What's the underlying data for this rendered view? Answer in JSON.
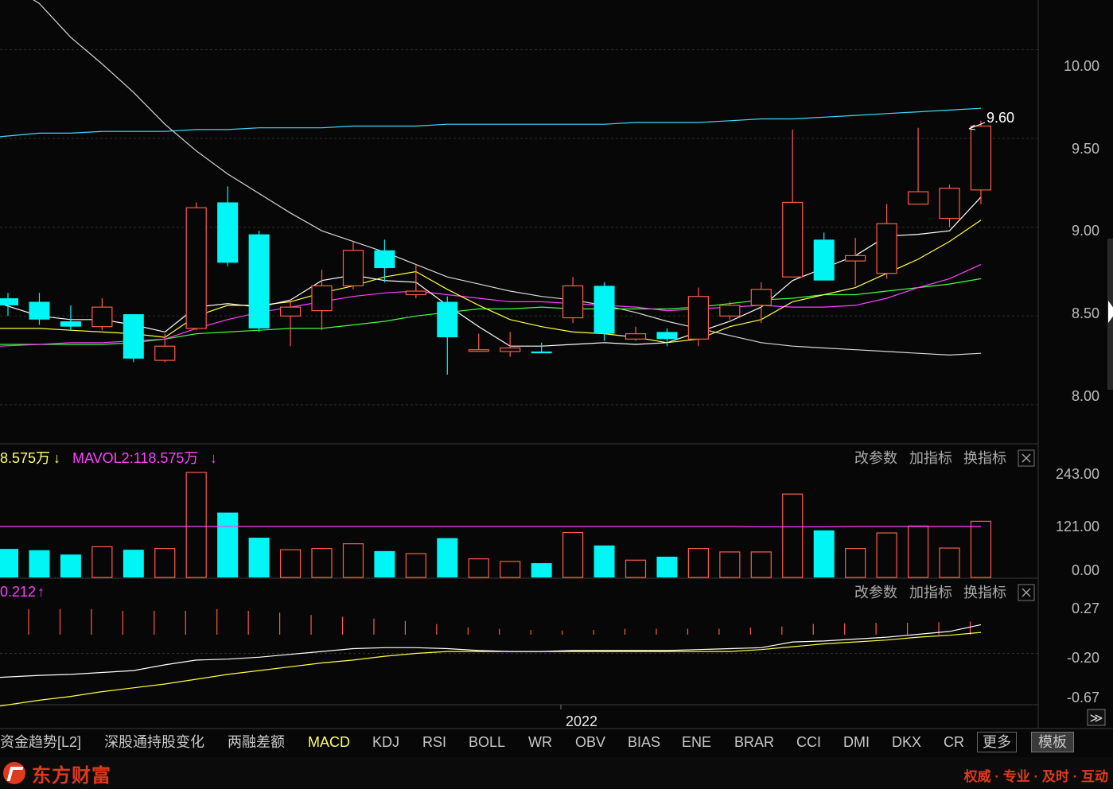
{
  "colors": {
    "up": "#ff5a4a",
    "down": "#00f5f5",
    "ma5": "#ffffff",
    "ma10": "#ffff40",
    "ma20": "#ff40ff",
    "ma30": "#40ff40",
    "ma60": "#e8e8e8",
    "ma250": "#40d8ff",
    "accent_text": "#ffff66",
    "brand": "#e03a1e"
  },
  "main_panel": {
    "y_ticks": [
      "10.00",
      "9.50",
      "9.00",
      "8.50",
      "8.00"
    ],
    "max_label": "9.60"
  },
  "volume_panel": {
    "legend_yellow": "8.575万",
    "legend_yellow_arrow": "↓",
    "legend_magenta": "MAVOL2:118.575万",
    "legend_magenta_arrow": "↓",
    "y_ticks": [
      "243.00",
      "121.00",
      "0.00"
    ],
    "buttons": {
      "params": "改参数",
      "add": "加指标",
      "swap": "换指标"
    }
  },
  "macd_panel": {
    "legend": "0.212",
    "legend_arrow": "↑",
    "y_ticks": [
      "0.27",
      "-0.20",
      "-0.67"
    ],
    "buttons": {
      "params": "改参数",
      "add": "加指标",
      "swap": "换指标"
    }
  },
  "x_axis": {
    "year_label": "2022",
    "expand_symbol": "≫"
  },
  "tabs": [
    "资金趋势[L2]",
    "深股通持股变化",
    "两融差额",
    "MACD",
    "KDJ",
    "RSI",
    "BOLL",
    "WR",
    "OBV",
    "BIAS",
    "ENE",
    "BRAR",
    "CCI",
    "DMI",
    "DKX",
    "CR"
  ],
  "active_tab": "MACD",
  "more_button": "更多",
  "template_button": "模板",
  "footer": {
    "logo_text": "东方财富",
    "slogan": "权威 · 专业 · 及时 · 互动"
  },
  "chart_data": {
    "type": "candlestick",
    "candles": [
      {
        "o": 8.6,
        "c": 8.56,
        "h": 8.63,
        "l": 8.5
      },
      {
        "o": 8.58,
        "c": 8.48,
        "h": 8.63,
        "l": 8.45
      },
      {
        "o": 8.47,
        "c": 8.44,
        "h": 8.56,
        "l": 8.42
      },
      {
        "o": 8.44,
        "c": 8.55,
        "h": 8.6,
        "l": 8.42
      },
      {
        "o": 8.51,
        "c": 8.26,
        "h": 8.51,
        "l": 8.24
      },
      {
        "o": 8.25,
        "c": 8.33,
        "h": 8.4,
        "l": 8.24
      },
      {
        "o": 8.43,
        "c": 9.11,
        "h": 9.14,
        "l": 8.42
      },
      {
        "o": 9.14,
        "c": 8.8,
        "h": 9.23,
        "l": 8.78
      },
      {
        "o": 8.96,
        "c": 8.43,
        "h": 8.98,
        "l": 8.41
      },
      {
        "o": 8.5,
        "c": 8.55,
        "h": 8.59,
        "l": 8.33
      },
      {
        "o": 8.53,
        "c": 8.67,
        "h": 8.76,
        "l": 8.42
      },
      {
        "o": 8.67,
        "c": 8.87,
        "h": 8.92,
        "l": 8.65
      },
      {
        "o": 8.87,
        "c": 8.77,
        "h": 8.93,
        "l": 8.69
      },
      {
        "o": 8.62,
        "c": 8.64,
        "h": 8.79,
        "l": 8.6
      },
      {
        "o": 8.58,
        "c": 8.38,
        "h": 8.61,
        "l": 8.17
      },
      {
        "o": 8.31,
        "c": 8.31,
        "h": 8.4,
        "l": 8.31
      },
      {
        "o": 8.3,
        "c": 8.32,
        "h": 8.41,
        "l": 8.27
      },
      {
        "o": 8.3,
        "c": 8.29,
        "h": 8.35,
        "l": 8.29
      },
      {
        "o": 8.49,
        "c": 8.67,
        "h": 8.72,
        "l": 8.46
      },
      {
        "o": 8.67,
        "c": 8.4,
        "h": 8.69,
        "l": 8.36
      },
      {
        "o": 8.37,
        "c": 8.4,
        "h": 8.44,
        "l": 8.36
      },
      {
        "o": 8.41,
        "c": 8.37,
        "h": 8.43,
        "l": 8.33
      },
      {
        "o": 8.37,
        "c": 8.61,
        "h": 8.66,
        "l": 8.33
      },
      {
        "o": 8.5,
        "c": 8.56,
        "h": 8.58,
        "l": 8.48
      },
      {
        "o": 8.56,
        "c": 8.65,
        "h": 8.69,
        "l": 8.46
      },
      {
        "o": 8.72,
        "c": 9.14,
        "h": 9.55,
        "l": 8.72
      },
      {
        "o": 8.93,
        "c": 8.7,
        "h": 8.97,
        "l": 8.7
      },
      {
        "o": 8.81,
        "c": 8.84,
        "h": 8.94,
        "l": 8.67
      },
      {
        "o": 8.74,
        "c": 9.02,
        "h": 9.13,
        "l": 8.71
      },
      {
        "o": 9.13,
        "c": 9.2,
        "h": 9.56,
        "l": 9.13
      },
      {
        "o": 9.05,
        "c": 9.22,
        "h": 9.24,
        "l": 9.0
      },
      {
        "o": 9.21,
        "c": 9.57,
        "h": 9.6,
        "l": 9.13
      }
    ],
    "volume": [
      66,
      63,
      53,
      71,
      64,
      67,
      243,
      150,
      92,
      64,
      67,
      78,
      61,
      55,
      91,
      43,
      37,
      33,
      104,
      74,
      40,
      48,
      67,
      59,
      59,
      193,
      109,
      67,
      103,
      119,
      68,
      130
    ],
    "mavol_line": [
      118,
      118,
      118,
      118,
      118,
      118,
      118,
      118,
      118,
      118,
      118,
      118,
      118,
      118,
      118,
      118,
      118,
      118,
      118,
      118,
      118,
      118,
      118,
      118,
      117,
      117,
      117,
      118,
      118,
      118,
      118,
      118
    ],
    "macd_hist": [
      0.43,
      0.43,
      0.43,
      0.4,
      0.4,
      0.4,
      0.43,
      0.4,
      0.37,
      0.33,
      0.3,
      0.27,
      0.23,
      0.18,
      0.12,
      0.1,
      0.08,
      0.07,
      0.08,
      0.1,
      0.1,
      0.1,
      0.1,
      0.12,
      0.14,
      0.18,
      0.19,
      0.2,
      0.2,
      0.21,
      0.22,
      0.23
    ],
    "dif_line": [
      -0.45,
      -0.43,
      -0.42,
      -0.4,
      -0.38,
      -0.32,
      -0.27,
      -0.26,
      -0.24,
      -0.21,
      -0.18,
      -0.15,
      -0.14,
      -0.14,
      -0.15,
      -0.17,
      -0.18,
      -0.18,
      -0.17,
      -0.17,
      -0.17,
      -0.17,
      -0.16,
      -0.15,
      -0.14,
      -0.08,
      -0.07,
      -0.05,
      -0.03,
      0.0,
      0.03,
      0.1
    ],
    "dea_line": [
      -0.75,
      -0.69,
      -0.65,
      -0.6,
      -0.56,
      -0.52,
      -0.47,
      -0.42,
      -0.38,
      -0.34,
      -0.3,
      -0.27,
      -0.23,
      -0.2,
      -0.18,
      -0.18,
      -0.18,
      -0.18,
      -0.18,
      -0.18,
      -0.18,
      -0.18,
      -0.18,
      -0.18,
      -0.16,
      -0.13,
      -0.1,
      -0.08,
      -0.06,
      -0.03,
      -0.01,
      0.02
    ],
    "ma5": [
      8.57,
      8.5,
      8.48,
      8.48,
      8.45,
      8.41,
      8.55,
      8.57,
      8.55,
      8.59,
      8.7,
      8.73,
      8.7,
      8.69,
      8.56,
      8.44,
      8.33,
      8.33,
      8.34,
      8.35,
      8.34,
      8.35,
      8.41,
      8.47,
      8.55,
      8.7,
      8.77,
      8.84,
      8.95,
      8.96,
      8.98,
      9.17
    ],
    "ma10": [
      8.43,
      8.43,
      8.42,
      8.41,
      8.4,
      8.38,
      8.5,
      8.56,
      8.56,
      8.58,
      8.63,
      8.67,
      8.72,
      8.75,
      8.65,
      8.56,
      8.48,
      8.44,
      8.41,
      8.4,
      8.38,
      8.35,
      8.37,
      8.44,
      8.48,
      8.58,
      8.62,
      8.66,
      8.74,
      8.82,
      8.92,
      9.04
    ],
    "ma20": [
      8.33,
      8.34,
      8.35,
      8.35,
      8.36,
      8.37,
      8.43,
      8.48,
      8.52,
      8.55,
      8.58,
      8.61,
      8.63,
      8.64,
      8.62,
      8.6,
      8.58,
      8.58,
      8.57,
      8.56,
      8.55,
      8.53,
      8.54,
      8.55,
      8.56,
      8.55,
      8.55,
      8.56,
      8.6,
      8.66,
      8.71,
      8.79
    ],
    "ma30": [
      8.34,
      8.34,
      8.34,
      8.34,
      8.35,
      8.37,
      8.4,
      8.41,
      8.42,
      8.43,
      8.43,
      8.45,
      8.47,
      8.5,
      8.52,
      8.54,
      8.54,
      8.55,
      8.54,
      8.54,
      8.54,
      8.54,
      8.55,
      8.57,
      8.59,
      8.6,
      8.62,
      8.62,
      8.64,
      8.66,
      8.68,
      8.71
    ],
    "ma60": [
      10.4,
      10.26,
      10.07,
      9.92,
      9.76,
      9.58,
      9.43,
      9.3,
      9.19,
      9.08,
      8.98,
      8.92,
      8.86,
      8.79,
      8.72,
      8.68,
      8.64,
      8.61,
      8.59,
      8.56,
      8.52,
      8.47,
      8.43,
      8.39,
      8.35,
      8.33,
      8.32,
      8.31,
      8.3,
      8.29,
      8.28,
      8.29
    ],
    "ma250": [
      9.51,
      9.53,
      9.53,
      9.54,
      9.54,
      9.54,
      9.55,
      9.55,
      9.56,
      9.56,
      9.56,
      9.57,
      9.57,
      9.57,
      9.58,
      9.58,
      9.58,
      9.58,
      9.58,
      9.58,
      9.59,
      9.59,
      9.59,
      9.6,
      9.61,
      9.61,
      9.62,
      9.63,
      9.64,
      9.65,
      9.66,
      9.67
    ],
    "price_range": [
      7.78,
      10.28
    ],
    "volume_range": [
      0,
      243
    ],
    "macd_range": [
      -0.67,
      0.27
    ]
  }
}
